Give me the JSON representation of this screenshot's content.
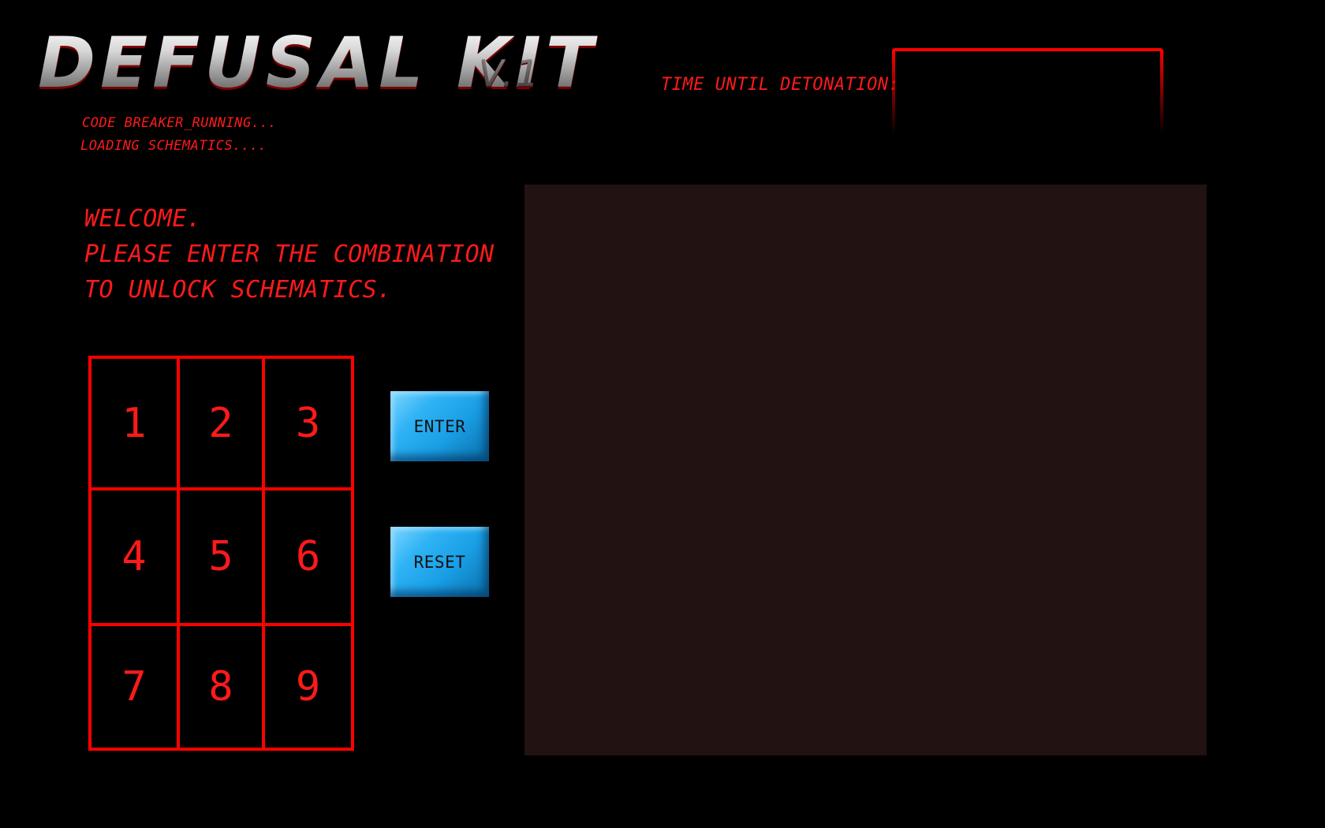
{
  "header": {
    "logo": "DEFUSAL KIT",
    "version": "V.1",
    "status_lines": [
      "CODE BREAKER_RUNNING...",
      "LOADING SCHEMATICS...."
    ],
    "timer_label": "TIME UNTIL DETONATION:",
    "timer_value": ""
  },
  "welcome": {
    "lines": [
      "WELCOME.",
      "PLEASE ENTER THE COMBINATION",
      "TO UNLOCK SCHEMATICS."
    ]
  },
  "keypad": {
    "keys": [
      "1",
      "2",
      "3",
      "4",
      "5",
      "6",
      "7",
      "8",
      "9"
    ]
  },
  "buttons": {
    "enter": "ENTER",
    "reset": "RESET"
  },
  "colors": {
    "accent": "#ff0000",
    "button": "#1fa8ef",
    "panel": "#221212",
    "background": "#000000"
  }
}
